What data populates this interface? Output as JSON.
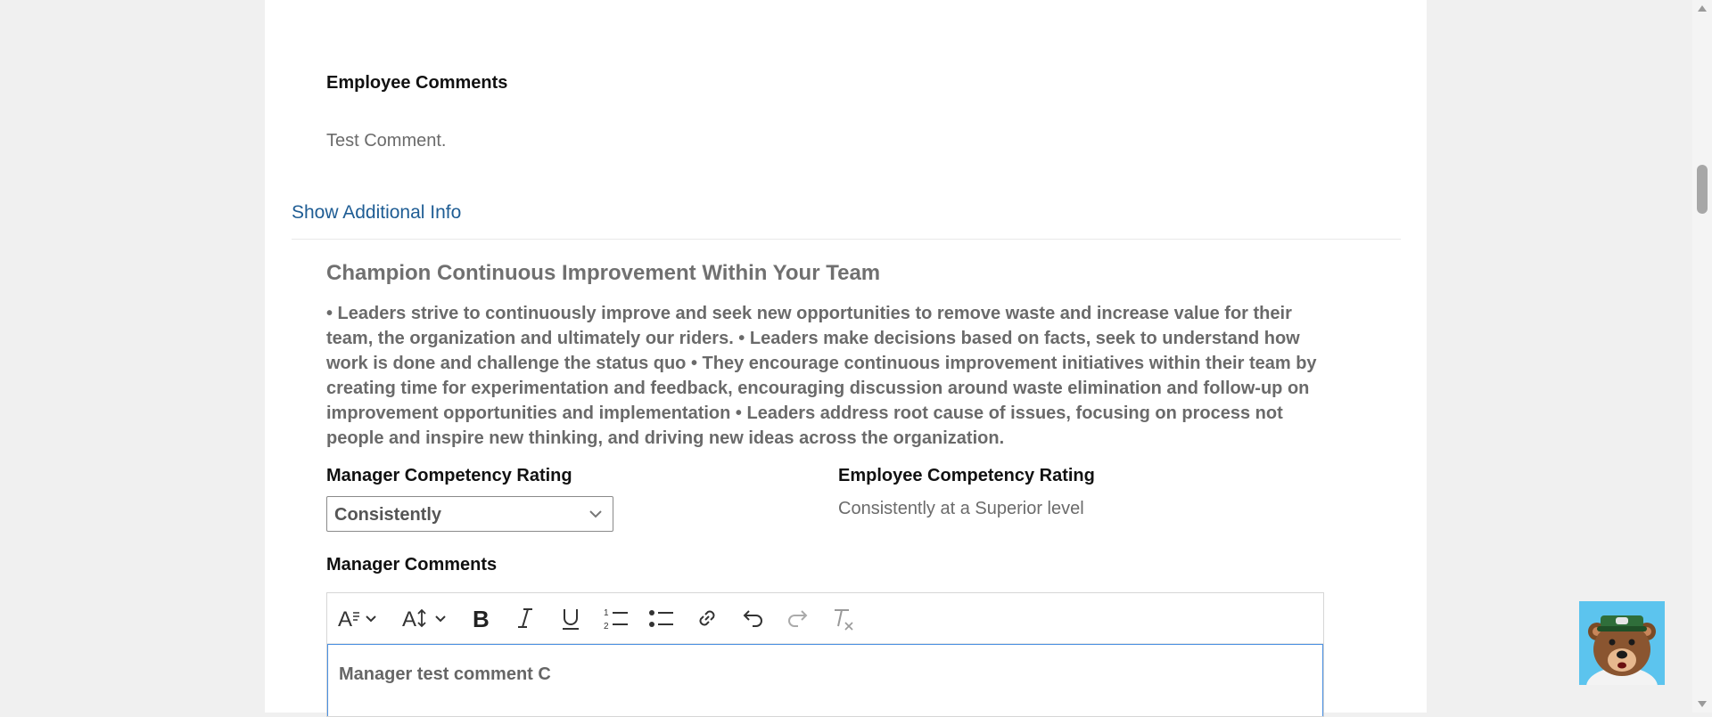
{
  "employee_comments": {
    "label": "Employee Comments",
    "value": "Test Comment."
  },
  "show_additional_info": "Show Additional Info",
  "competency": {
    "title": "Champion Continuous Improvement Within Your Team",
    "description_lines": [
      "• Leaders strive to continuously improve and seek new opportunities to remove waste and increase value for their",
      "team, the organization and ultimately our riders. • Leaders make decisions based on facts, seek to understand how",
      "work is done and challenge the status quo • They encourage continuous improvement initiatives within their team by",
      "creating time for experimentation and feedback, encouraging discussion around waste elimination and follow-up on",
      "improvement opportunities and implementation • Leaders address root cause of issues, focusing on process not",
      "people and inspire new thinking, and driving new ideas across the organization."
    ],
    "manager_rating_label": "Manager Competency Rating",
    "manager_rating_value": "Consistently",
    "employee_rating_label": "Employee Competency Rating",
    "employee_rating_value": "Consistently at a Superior level"
  },
  "manager_comments": {
    "label": "Manager Comments",
    "value": "Manager test comment C"
  },
  "toolbar": {
    "icons": [
      "font-family-icon",
      "font-size-icon",
      "bold-icon",
      "italic-icon",
      "underline-icon",
      "numbered-list-icon",
      "bullet-list-icon",
      "link-icon",
      "undo-icon",
      "redo-icon",
      "clear-format-icon"
    ]
  },
  "colors": {
    "page_bg": "#f0f0f0",
    "card_bg": "#ffffff",
    "link": "#1f5d94",
    "editor_focus": "#4a90e2",
    "mascot_bg": "#5cc4ee"
  }
}
